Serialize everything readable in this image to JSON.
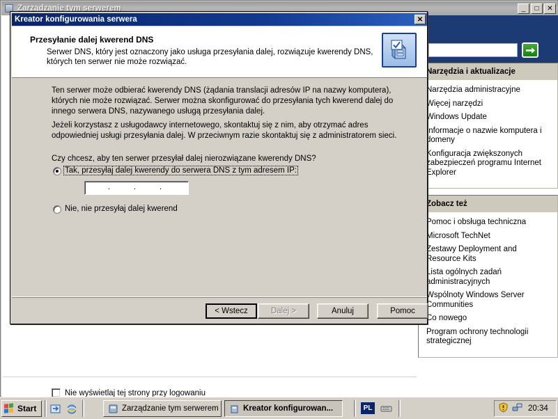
{
  "background_window": {
    "title": "Zarządzanie tym serwerem",
    "minimize_label": "_",
    "maximize_label": "□",
    "close_label": "✕",
    "search": {
      "value": "",
      "placeholder": "",
      "go_label": "→"
    },
    "sections": [
      {
        "header": "Narzędzia i aktualizacje",
        "header_accesskey": "N",
        "links": [
          "Narzędzia administracyjne",
          "Więcej narzędzi",
          "Windows Update",
          "Informacje o nazwie komputera i domeny",
          "Konfiguracja zwiększonych zabezpieczeń programu Internet Explorer"
        ]
      },
      {
        "header": "Zobacz też",
        "header_accesskey": "Z",
        "links": [
          "Pomoc i obsługa techniczna",
          "Microsoft TechNet",
          "Zestawy Deployment and Resource Kits",
          "Lista ogólnych zadań administracyjnych",
          "Wspólnoty Windows Server Communities",
          "Co nowego",
          "Program ochrony technologii strategicznej"
        ]
      }
    ],
    "startup_checkbox": {
      "label_pre": "Ni",
      "label_accesskey": "e",
      "label_post": ", nie wyświetlaj tej strony przy logowaniu",
      "full_label": "Nie wyświetlaj tej strony przy logowaniu",
      "checked": false
    }
  },
  "dialog": {
    "title": "Kreator konfigurowania serwera",
    "close_label": "✕",
    "header": {
      "title": "Przesyłanie dalej kwerend DNS",
      "subtitle": "Serwer DNS, który jest oznaczony jako usługa przesyłania dalej, rozwiązuje kwerendy DNS, których ten serwer nie może rozwiązać.",
      "icon": "server-checklist-icon"
    },
    "body": {
      "paragraph1": "Ten serwer może odbierać kwerendy DNS (żądania translacji adresów IP na nazwy komputera), których nie może rozwiązać. Serwer można skonfigurować do przesyłania tych kwerend dalej do innego serwera DNS, nazywanego usługą przesyłania dalej.",
      "paragraph2": "Jeżeli korzystasz z usługodawcy internetowego, skontaktuj się z nim, aby otrzymać adres odpowiedniej usługi przesyłania dalej. W przeciwnym razie skontaktuj się z administratorem sieci.",
      "question": "Czy chcesz, aby ten serwer przesyłał dalej nierozwiązane kwerendy DNS?",
      "radio_yes": {
        "label_pre": "",
        "label_accesskey": "T",
        "label_post": "ak, przesyłaj dalej kwerendy do serwera DNS z tym adresem IP:",
        "full_label": "Tak, przesyłaj dalej kwerendy do serwera DNS z tym adresem IP:",
        "selected": true,
        "focused": true
      },
      "radio_no": {
        "label_pre": "",
        "label_accesskey": "N",
        "label_post": "ie, nie przesyłaj dalej kwerend",
        "full_label": "Nie, nie przesyłaj dalej kwerend",
        "selected": false
      },
      "ip_field": {
        "octet1": "",
        "octet2": "",
        "octet3": "",
        "octet4": "",
        "separator": "."
      }
    },
    "buttons": {
      "back": {
        "pre": "< ",
        "accesskey": "W",
        "post": "stecz",
        "full": "< Wstecz",
        "disabled": false,
        "default": true
      },
      "next": {
        "pre": "",
        "accesskey": "D",
        "post": "alej >",
        "full": "Dalej >",
        "disabled": true,
        "default": false
      },
      "cancel": {
        "pre": "",
        "accesskey": "",
        "post": "Anuluj",
        "full": "Anuluj",
        "disabled": false,
        "default": false
      },
      "help": {
        "pre": "",
        "accesskey": "",
        "post": "Pomoc",
        "full": "Pomoc",
        "disabled": false,
        "default": false
      }
    }
  },
  "taskbar": {
    "start_label": "Start",
    "quick_launch": [
      "show-desktop-icon",
      "internet-explorer-icon"
    ],
    "tasks": [
      {
        "label": "Zarządzanie tym serwerem",
        "active": false
      },
      {
        "label": "Kreator konfigurowan...",
        "active": true
      }
    ],
    "language_indicator": "PL",
    "tray_icons": [
      "security-shield-icon",
      "network-connection-icon"
    ],
    "clock": "20:34"
  },
  "colors": {
    "title_blue": "#0a246a",
    "face": "#d4d0c8",
    "panel_header": "#cdcabc",
    "dark_blue_header": "#1c3a74",
    "green_go": "#2f8a22"
  }
}
